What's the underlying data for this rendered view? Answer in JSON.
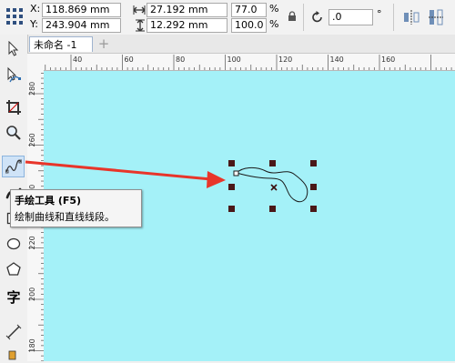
{
  "property_bar": {
    "x_label": "X:",
    "x_value": "118.869 mm",
    "y_label": "Y:",
    "y_value": "243.904 mm",
    "width_value": "27.192 mm",
    "height_value": "12.292 mm",
    "scale_x": "77.0",
    "scale_y": "100.0",
    "percent_symbol": "%",
    "rotation_value": ".0",
    "degree_symbol": "°"
  },
  "document_tab": {
    "label": "未命名 -1",
    "add_tab_symbol": "+"
  },
  "ruler_top": {
    "ticks": [
      "40",
      "60",
      "80",
      "100",
      "120",
      "140",
      "160"
    ]
  },
  "ruler_left": {
    "ticks": [
      "280",
      "260",
      "240",
      "220",
      "200",
      "180"
    ]
  },
  "tooltip": {
    "title": "手绘工具 (F5)",
    "description": "绘制曲线和直线线段。"
  },
  "colors": {
    "canvas": "#a4f1f8",
    "arrow": "#e8352a",
    "handles": "#4a1818",
    "active_tool_bg": "#cfe3f7"
  },
  "icons": {
    "pick_tool": "arrow-pointer-icon",
    "shape_tool": "shape-node-icon",
    "crop_tool": "crop-icon",
    "zoom_tool": "zoom-icon",
    "freehand_tool": "freehand-icon",
    "artistic_media_tool": "artistic-media-icon",
    "rectangle_tool": "rectangle-icon",
    "ellipse_tool": "ellipse-icon",
    "polygon_tool": "polygon-icon",
    "text_tool": "text-icon",
    "dimension_tool": "dimension-icon",
    "fill_tool": "fill-icon"
  }
}
